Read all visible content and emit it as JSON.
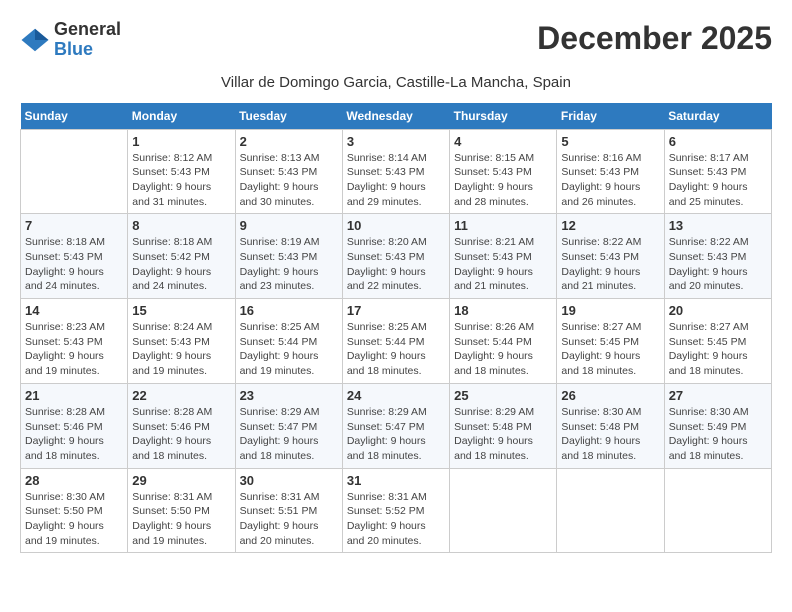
{
  "logo": {
    "general": "General",
    "blue": "Blue"
  },
  "title": "December 2025",
  "subtitle": "Villar de Domingo Garcia, Castille-La Mancha, Spain",
  "days_header": [
    "Sunday",
    "Monday",
    "Tuesday",
    "Wednesday",
    "Thursday",
    "Friday",
    "Saturday"
  ],
  "weeks": [
    [
      {
        "day": "",
        "sunrise": "",
        "sunset": "",
        "daylight": ""
      },
      {
        "day": "1",
        "sunrise": "Sunrise: 8:12 AM",
        "sunset": "Sunset: 5:43 PM",
        "daylight": "Daylight: 9 hours and 31 minutes."
      },
      {
        "day": "2",
        "sunrise": "Sunrise: 8:13 AM",
        "sunset": "Sunset: 5:43 PM",
        "daylight": "Daylight: 9 hours and 30 minutes."
      },
      {
        "day": "3",
        "sunrise": "Sunrise: 8:14 AM",
        "sunset": "Sunset: 5:43 PM",
        "daylight": "Daylight: 9 hours and 29 minutes."
      },
      {
        "day": "4",
        "sunrise": "Sunrise: 8:15 AM",
        "sunset": "Sunset: 5:43 PM",
        "daylight": "Daylight: 9 hours and 28 minutes."
      },
      {
        "day": "5",
        "sunrise": "Sunrise: 8:16 AM",
        "sunset": "Sunset: 5:43 PM",
        "daylight": "Daylight: 9 hours and 26 minutes."
      },
      {
        "day": "6",
        "sunrise": "Sunrise: 8:17 AM",
        "sunset": "Sunset: 5:43 PM",
        "daylight": "Daylight: 9 hours and 25 minutes."
      }
    ],
    [
      {
        "day": "7",
        "sunrise": "Sunrise: 8:18 AM",
        "sunset": "Sunset: 5:43 PM",
        "daylight": "Daylight: 9 hours and 24 minutes."
      },
      {
        "day": "8",
        "sunrise": "Sunrise: 8:18 AM",
        "sunset": "Sunset: 5:42 PM",
        "daylight": "Daylight: 9 hours and 24 minutes."
      },
      {
        "day": "9",
        "sunrise": "Sunrise: 8:19 AM",
        "sunset": "Sunset: 5:43 PM",
        "daylight": "Daylight: 9 hours and 23 minutes."
      },
      {
        "day": "10",
        "sunrise": "Sunrise: 8:20 AM",
        "sunset": "Sunset: 5:43 PM",
        "daylight": "Daylight: 9 hours and 22 minutes."
      },
      {
        "day": "11",
        "sunrise": "Sunrise: 8:21 AM",
        "sunset": "Sunset: 5:43 PM",
        "daylight": "Daylight: 9 hours and 21 minutes."
      },
      {
        "day": "12",
        "sunrise": "Sunrise: 8:22 AM",
        "sunset": "Sunset: 5:43 PM",
        "daylight": "Daylight: 9 hours and 21 minutes."
      },
      {
        "day": "13",
        "sunrise": "Sunrise: 8:22 AM",
        "sunset": "Sunset: 5:43 PM",
        "daylight": "Daylight: 9 hours and 20 minutes."
      }
    ],
    [
      {
        "day": "14",
        "sunrise": "Sunrise: 8:23 AM",
        "sunset": "Sunset: 5:43 PM",
        "daylight": "Daylight: 9 hours and 19 minutes."
      },
      {
        "day": "15",
        "sunrise": "Sunrise: 8:24 AM",
        "sunset": "Sunset: 5:43 PM",
        "daylight": "Daylight: 9 hours and 19 minutes."
      },
      {
        "day": "16",
        "sunrise": "Sunrise: 8:25 AM",
        "sunset": "Sunset: 5:44 PM",
        "daylight": "Daylight: 9 hours and 19 minutes."
      },
      {
        "day": "17",
        "sunrise": "Sunrise: 8:25 AM",
        "sunset": "Sunset: 5:44 PM",
        "daylight": "Daylight: 9 hours and 18 minutes."
      },
      {
        "day": "18",
        "sunrise": "Sunrise: 8:26 AM",
        "sunset": "Sunset: 5:44 PM",
        "daylight": "Daylight: 9 hours and 18 minutes."
      },
      {
        "day": "19",
        "sunrise": "Sunrise: 8:27 AM",
        "sunset": "Sunset: 5:45 PM",
        "daylight": "Daylight: 9 hours and 18 minutes."
      },
      {
        "day": "20",
        "sunrise": "Sunrise: 8:27 AM",
        "sunset": "Sunset: 5:45 PM",
        "daylight": "Daylight: 9 hours and 18 minutes."
      }
    ],
    [
      {
        "day": "21",
        "sunrise": "Sunrise: 8:28 AM",
        "sunset": "Sunset: 5:46 PM",
        "daylight": "Daylight: 9 hours and 18 minutes."
      },
      {
        "day": "22",
        "sunrise": "Sunrise: 8:28 AM",
        "sunset": "Sunset: 5:46 PM",
        "daylight": "Daylight: 9 hours and 18 minutes."
      },
      {
        "day": "23",
        "sunrise": "Sunrise: 8:29 AM",
        "sunset": "Sunset: 5:47 PM",
        "daylight": "Daylight: 9 hours and 18 minutes."
      },
      {
        "day": "24",
        "sunrise": "Sunrise: 8:29 AM",
        "sunset": "Sunset: 5:47 PM",
        "daylight": "Daylight: 9 hours and 18 minutes."
      },
      {
        "day": "25",
        "sunrise": "Sunrise: 8:29 AM",
        "sunset": "Sunset: 5:48 PM",
        "daylight": "Daylight: 9 hours and 18 minutes."
      },
      {
        "day": "26",
        "sunrise": "Sunrise: 8:30 AM",
        "sunset": "Sunset: 5:48 PM",
        "daylight": "Daylight: 9 hours and 18 minutes."
      },
      {
        "day": "27",
        "sunrise": "Sunrise: 8:30 AM",
        "sunset": "Sunset: 5:49 PM",
        "daylight": "Daylight: 9 hours and 18 minutes."
      }
    ],
    [
      {
        "day": "28",
        "sunrise": "Sunrise: 8:30 AM",
        "sunset": "Sunset: 5:50 PM",
        "daylight": "Daylight: 9 hours and 19 minutes."
      },
      {
        "day": "29",
        "sunrise": "Sunrise: 8:31 AM",
        "sunset": "Sunset: 5:50 PM",
        "daylight": "Daylight: 9 hours and 19 minutes."
      },
      {
        "day": "30",
        "sunrise": "Sunrise: 8:31 AM",
        "sunset": "Sunset: 5:51 PM",
        "daylight": "Daylight: 9 hours and 20 minutes."
      },
      {
        "day": "31",
        "sunrise": "Sunrise: 8:31 AM",
        "sunset": "Sunset: 5:52 PM",
        "daylight": "Daylight: 9 hours and 20 minutes."
      },
      {
        "day": "",
        "sunrise": "",
        "sunset": "",
        "daylight": ""
      },
      {
        "day": "",
        "sunrise": "",
        "sunset": "",
        "daylight": ""
      },
      {
        "day": "",
        "sunrise": "",
        "sunset": "",
        "daylight": ""
      }
    ]
  ]
}
